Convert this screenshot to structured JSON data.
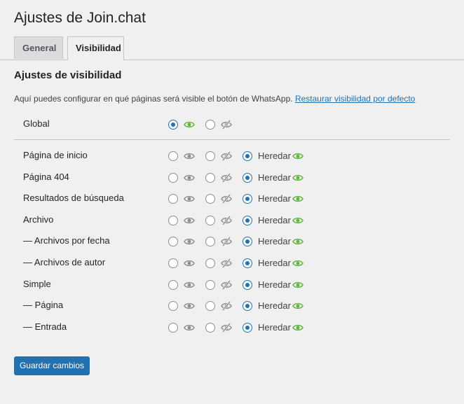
{
  "page": {
    "title": "Ajustes de Join.chat"
  },
  "tabs": [
    {
      "label": "General",
      "active": false
    },
    {
      "label": "Visibilidad",
      "active": true
    }
  ],
  "section": {
    "title": "Ajustes de visibilidad",
    "description": "Aquí puedes configurar en qué páginas será visible el botón de WhatsApp.",
    "reset_link": "Restaurar visibilidad por defecto"
  },
  "colors": {
    "accent": "#2271b1",
    "eye_visible": "#5fb63d",
    "eye_muted": "#8c8f94"
  },
  "icons": {
    "visible": "eye-icon",
    "hidden": "eye-slash-icon"
  },
  "global_row": {
    "label": "Global",
    "selected": "show"
  },
  "inherit_label": "Heredar",
  "rows": [
    {
      "label": "Página de inicio",
      "selected": "inherit"
    },
    {
      "label": "Página 404",
      "selected": "inherit"
    },
    {
      "label": "Resultados de búsqueda",
      "selected": "inherit"
    },
    {
      "label": "Archivo",
      "selected": "inherit"
    },
    {
      "label": "— Archivos por fecha",
      "selected": "inherit"
    },
    {
      "label": "— Archivos de autor",
      "selected": "inherit"
    },
    {
      "label": "Simple",
      "selected": "inherit"
    },
    {
      "label": "— Página",
      "selected": "inherit"
    },
    {
      "label": "— Entrada",
      "selected": "inherit"
    }
  ],
  "actions": {
    "save_label": "Guardar cambios"
  }
}
